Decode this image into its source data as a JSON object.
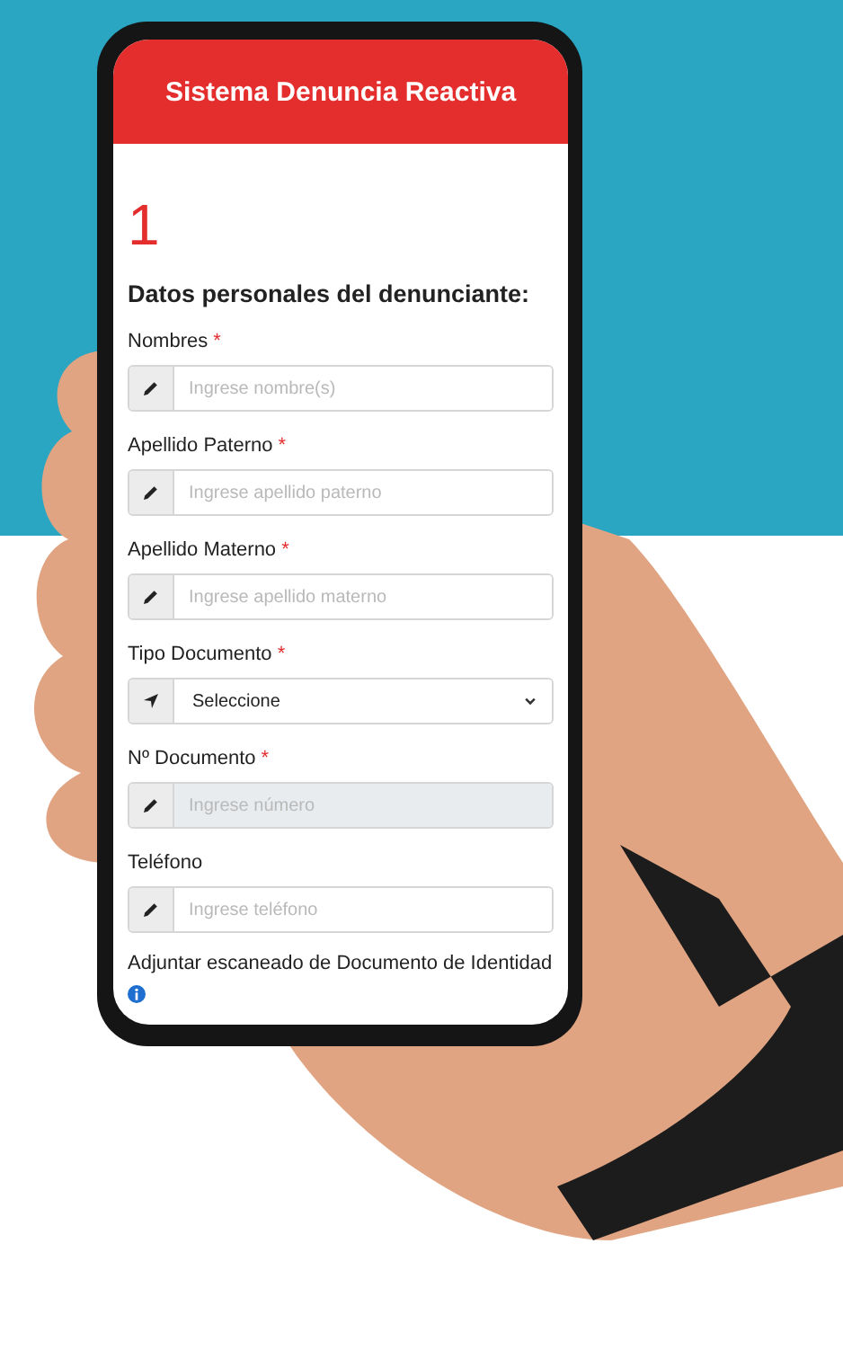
{
  "app_header": {
    "title": "Sistema Denuncia Reactiva"
  },
  "step": {
    "number": "1"
  },
  "section": {
    "title": "Datos personales del denunciante:"
  },
  "fields": [
    {
      "kind": "text",
      "label": "Nombres",
      "required_mark": "*",
      "placeholder": "Ingrese nombre(s)",
      "disabled": false
    },
    {
      "kind": "text",
      "label": "Apellido Paterno",
      "required_mark": "*",
      "placeholder": "Ingrese apellido paterno",
      "disabled": false
    },
    {
      "kind": "text",
      "label": "Apellido Materno",
      "required_mark": "*",
      "placeholder": "Ingrese apellido materno",
      "disabled": false
    },
    {
      "kind": "select",
      "label": "Tipo Documento",
      "required_mark": "*",
      "value": "Seleccione",
      "disabled": false
    },
    {
      "kind": "text",
      "label": "Nº Documento",
      "required_mark": "*",
      "placeholder": "Ingrese número",
      "disabled": true
    },
    {
      "kind": "text",
      "label": "Teléfono",
      "placeholder": "Ingrese teléfono",
      "disabled": false
    }
  ],
  "attachment": {
    "label": "Adjuntar escaneado de Documento de Identidad"
  }
}
